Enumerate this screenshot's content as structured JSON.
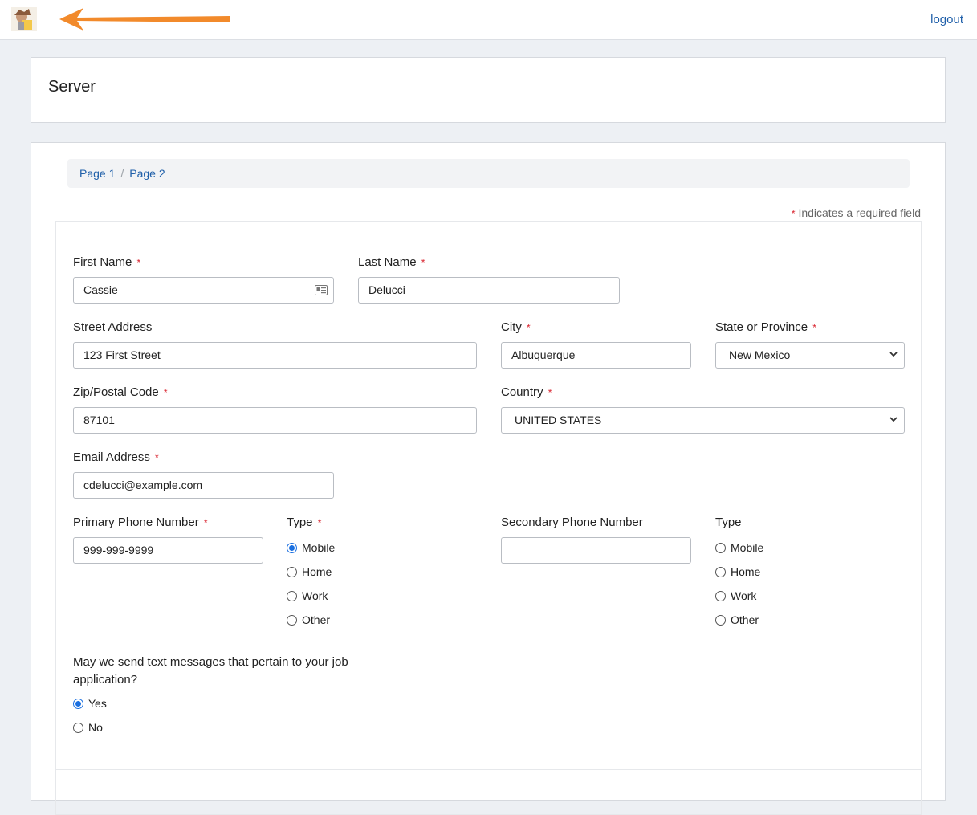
{
  "header": {
    "logout_label": "logout"
  },
  "page": {
    "title": "Server"
  },
  "breadcrumb": {
    "items": [
      "Page 1",
      "Page 2"
    ],
    "separator": "/"
  },
  "form": {
    "required_note": "Indicates a required field",
    "required_marker": "*",
    "first_name": {
      "label": "First Name",
      "value": "Cassie"
    },
    "last_name": {
      "label": "Last Name",
      "value": "Delucci"
    },
    "street": {
      "label": "Street Address",
      "value": "123 First Street"
    },
    "city": {
      "label": "City",
      "value": "Albuquerque"
    },
    "state": {
      "label": "State or Province",
      "value": "New Mexico"
    },
    "zip": {
      "label": "Zip/Postal Code",
      "value": "87101"
    },
    "country": {
      "label": "Country",
      "value": "UNITED STATES"
    },
    "email": {
      "label": "Email Address",
      "value": "cdelucci@example.com"
    },
    "primary_phone": {
      "label": "Primary Phone Number",
      "value": "999-999-9999"
    },
    "primary_type": {
      "label": "Type",
      "options": [
        "Mobile",
        "Home",
        "Work",
        "Other"
      ],
      "selected": "Mobile"
    },
    "secondary_phone": {
      "label": "Secondary Phone Number",
      "value": ""
    },
    "secondary_type": {
      "label": "Type",
      "options": [
        "Mobile",
        "Home",
        "Work",
        "Other"
      ],
      "selected": ""
    },
    "text_consent": {
      "question": "May we send text messages that pertain to your job application?",
      "options": [
        "Yes",
        "No"
      ],
      "selected": "Yes"
    }
  },
  "colors": {
    "link": "#1f5fa9",
    "required": "#d9232e",
    "radio_selected": "#1a6fe0",
    "arrow": "#f28a2b"
  }
}
